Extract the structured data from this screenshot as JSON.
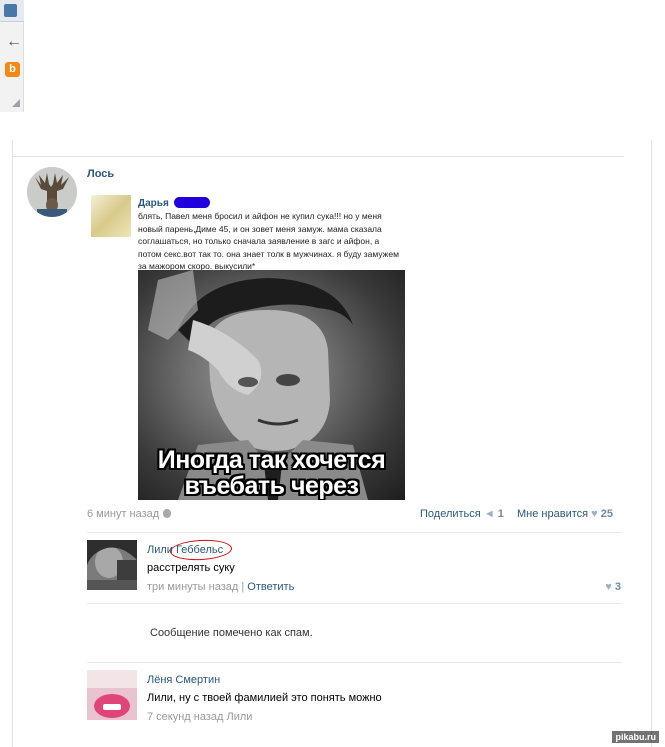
{
  "post": {
    "author": "Лось",
    "embedded": {
      "name": "Дарья",
      "text": "блять, Павел меня бросил и айфон не купил сука!!! но у меня новый парень,Диме 45, и он зовет меня замуж. мама сказала соглашаться, но только сначала заявление в загс и айфон, а потом секс.вот так то. она знает толк в мужчинах. я буду замужем за мажором скоро. выкусили*",
      "caption_line1": "Иногда так хочется",
      "caption_line2": "въебать через монитор"
    },
    "time": "6 минут назад",
    "share_label": "Поделиться",
    "share_count": "1",
    "like_label": "Мне нравится",
    "like_count": "25"
  },
  "comments": [
    {
      "name_first": "Лили",
      "name_last": "Геббельс",
      "text": "расстрелять суку",
      "time": "три минуты назад",
      "sep": "|",
      "reply": "Ответить",
      "likes": "3"
    },
    {
      "spam_text": "Сообщение помечено как спам."
    },
    {
      "name": "Лёня Смертин",
      "text": "Лили, ну с твоей фамилией это понять можно",
      "time": "7 секунд назад",
      "reply_to": "Лили"
    }
  ],
  "watermark": "pikabu.ru",
  "colors": {
    "link": "#2b587a",
    "muted": "#999999",
    "ring": "#cc1111"
  }
}
